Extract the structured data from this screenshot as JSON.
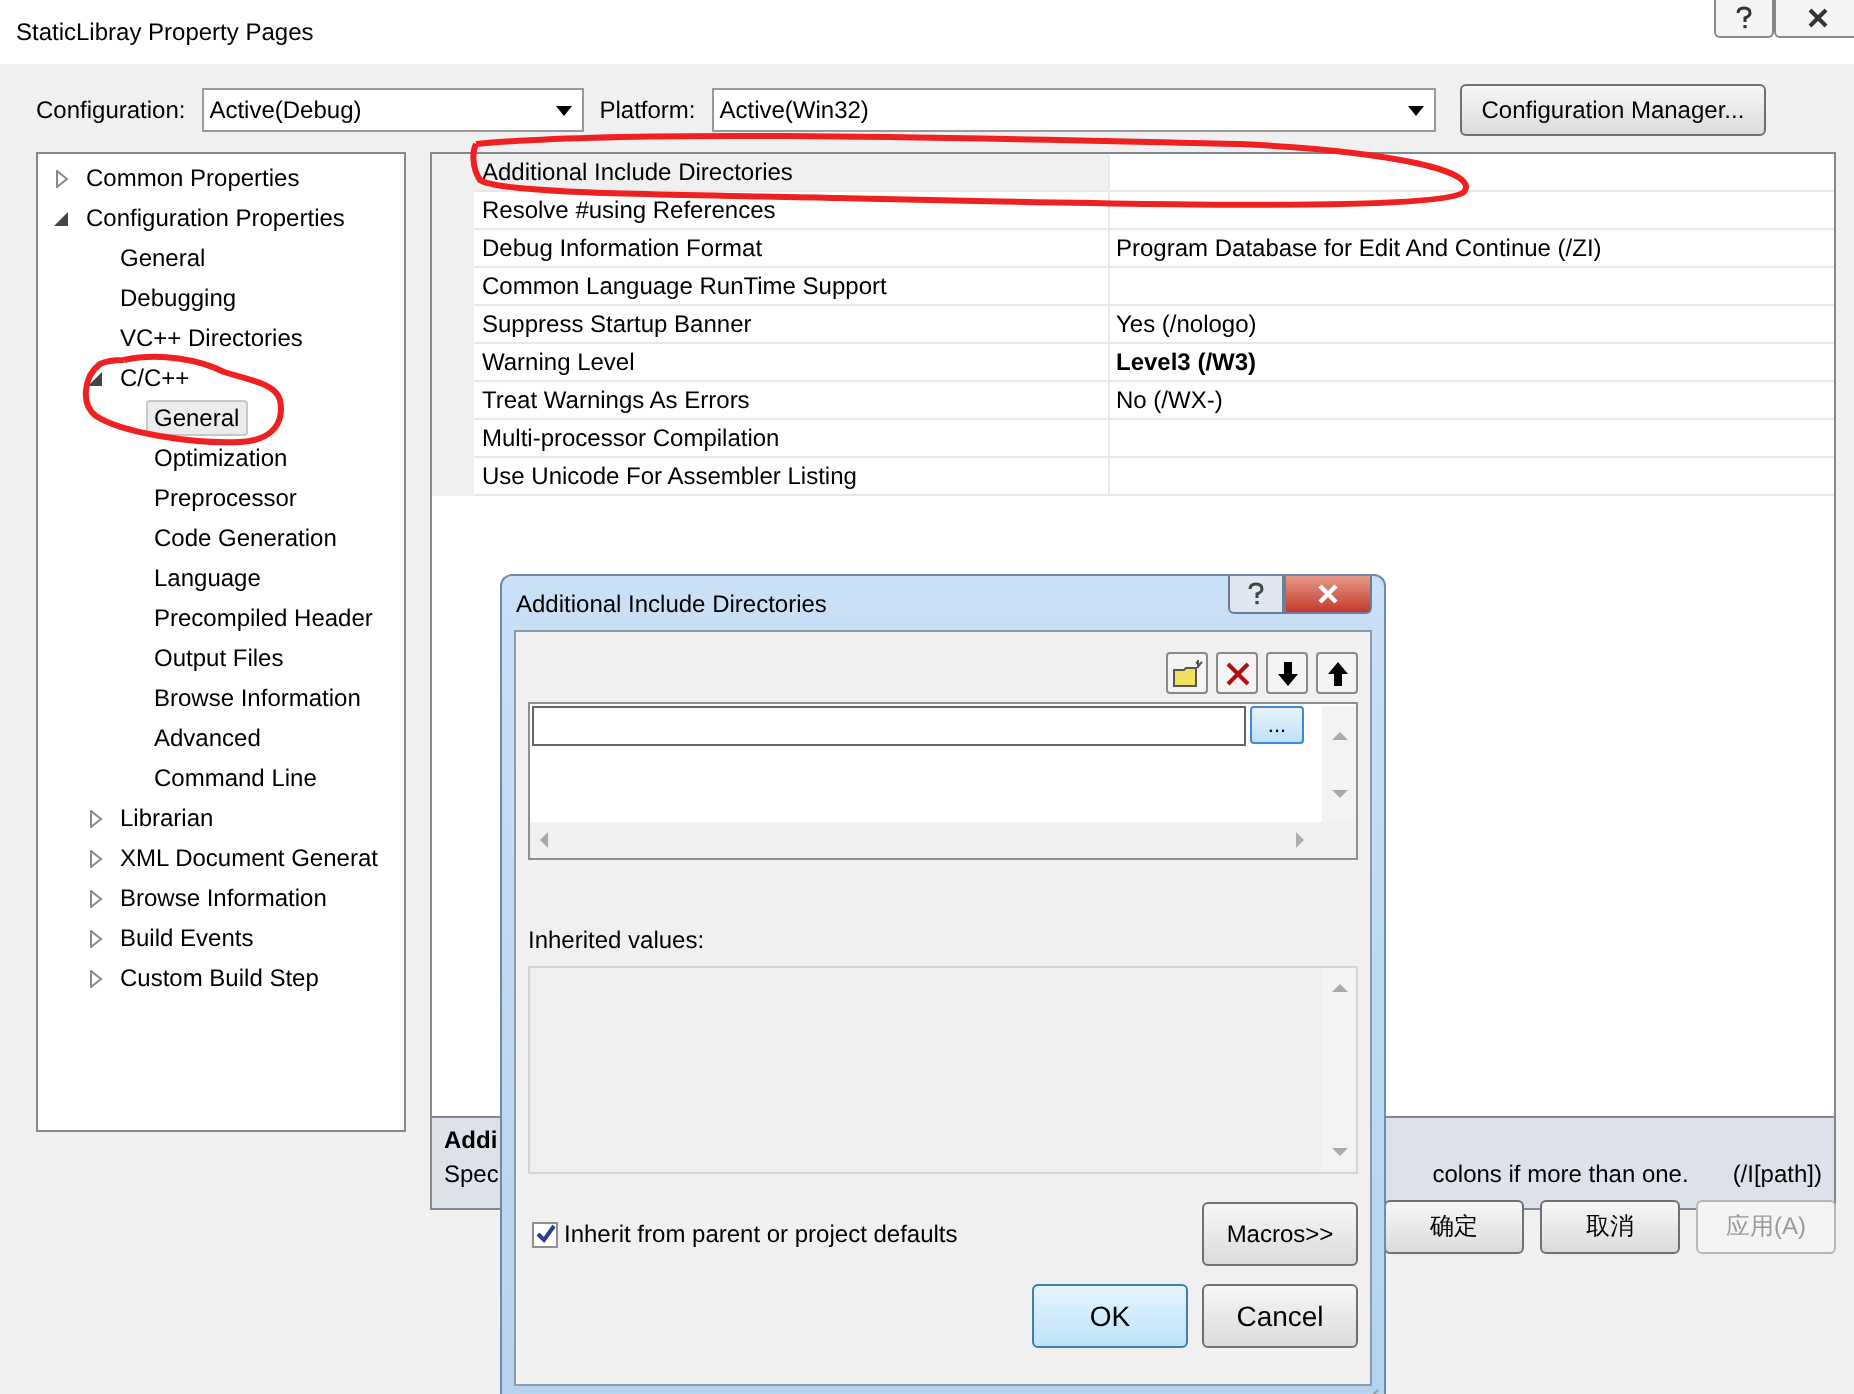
{
  "window": {
    "title": "StaticLibray Property Pages"
  },
  "configuration": {
    "label": "Configuration:",
    "value": "Active(Debug)"
  },
  "platform": {
    "label": "Platform:",
    "value": "Active(Win32)"
  },
  "config_manager_button": "Configuration Manager...",
  "tree": [
    {
      "label": "Common Properties",
      "expanded": false,
      "selected": false
    },
    {
      "label": "Configuration Properties",
      "expanded": true,
      "selected": false,
      "children": [
        {
          "label": "General",
          "selected": false
        },
        {
          "label": "Debugging",
          "selected": false
        },
        {
          "label": "VC++ Directories",
          "selected": false
        },
        {
          "label": "C/C++",
          "expanded": true,
          "selected": false,
          "children": [
            {
              "label": "General",
              "selected": true
            },
            {
              "label": "Optimization",
              "selected": false
            },
            {
              "label": "Preprocessor",
              "selected": false
            },
            {
              "label": "Code Generation",
              "selected": false
            },
            {
              "label": "Language",
              "selected": false
            },
            {
              "label": "Precompiled Header",
              "selected": false
            },
            {
              "label": "Output Files",
              "selected": false
            },
            {
              "label": "Browse Information",
              "selected": false
            },
            {
              "label": "Advanced",
              "selected": false
            },
            {
              "label": "Command Line",
              "selected": false
            }
          ]
        },
        {
          "label": "Librarian",
          "expanded": false,
          "selected": false
        },
        {
          "label": "XML Document Generat",
          "expanded": false,
          "selected": false
        },
        {
          "label": "Browse Information",
          "expanded": false,
          "selected": false
        },
        {
          "label": "Build Events",
          "expanded": false,
          "selected": false
        },
        {
          "label": "Custom Build Step",
          "expanded": false,
          "selected": false
        }
      ]
    }
  ],
  "properties": [
    {
      "name": "Additional Include Directories",
      "selected": true
    },
    {
      "name": "Resolve #using References",
      "selected": false
    },
    {
      "name": "Debug Information Format",
      "value": "Program Database for Edit And Continue (/ZI)",
      "selected": false,
      "modified": false
    },
    {
      "name": "Common Language RunTime Support",
      "selected": false
    },
    {
      "name": "Suppress Startup Banner",
      "value": "Yes (/nologo)",
      "selected": false,
      "modified": false
    },
    {
      "name": "Warning Level",
      "value": "Level3 (/W3)",
      "selected": false,
      "modified": true
    },
    {
      "name": "Treat Warnings As Errors",
      "value": "No (/WX-)",
      "selected": false,
      "modified": false
    },
    {
      "name": "Multi-processor Compilation",
      "selected": false
    },
    {
      "name": "Use Unicode For Assembler Listing",
      "selected": false
    }
  ],
  "description": {
    "title": "Addi",
    "text_start": "Spec",
    "text_end": "colons if more than one.",
    "command_line": "(/I[path])"
  },
  "buttons": [
    {
      "label": "确定",
      "disabled": false
    },
    {
      "label": "取消",
      "disabled": false
    },
    {
      "label": "应用(A)",
      "disabled": true
    }
  ],
  "dialog": {
    "title": "Additional Include Directories",
    "browse_button": "...",
    "inherited_label": "Inherited values:",
    "inherit_checkbox": {
      "label": "Inherit from parent or project defaults",
      "checked": true
    },
    "macros_button": "Macros>>",
    "buttons": [
      {
        "label": "OK",
        "default": true
      },
      {
        "label": "Cancel",
        "default": false
      }
    ]
  }
}
